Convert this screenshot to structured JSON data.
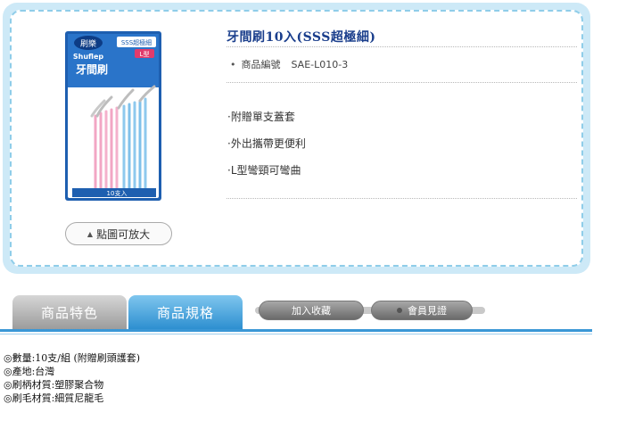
{
  "product": {
    "title": "牙間刷10入(SSS超極細)",
    "code_label": "商品編號",
    "code": "SAE-L010-3",
    "features": [
      "·附贈單支蓋套",
      "·外出攜帶更便利",
      "·L型彎頸可彎曲"
    ],
    "zoom_label": "點圖可放大",
    "image": {
      "brand_text": "刷樂",
      "brand_en": "Shuflep",
      "name_text": "牙間刷",
      "size_text": "SSS超極細",
      "type_text": "L型",
      "count_text": "10支入"
    }
  },
  "tabs": {
    "features_label": "商品特色",
    "specs_label": "商品規格",
    "add_fav_label": "加入收藏",
    "member_label": "會員見證"
  },
  "specs": [
    "◎數量:10支/組 (附贈刷頭護套)",
    "◎產地:台灣",
    "◎刷柄材質:塑膠聚合物",
    "◎刷毛材質:細質尼龍毛"
  ],
  "colors": {
    "card_border": "#8fcde9",
    "title": "#1a3e8c",
    "active_tab": "#2d8fd0"
  }
}
